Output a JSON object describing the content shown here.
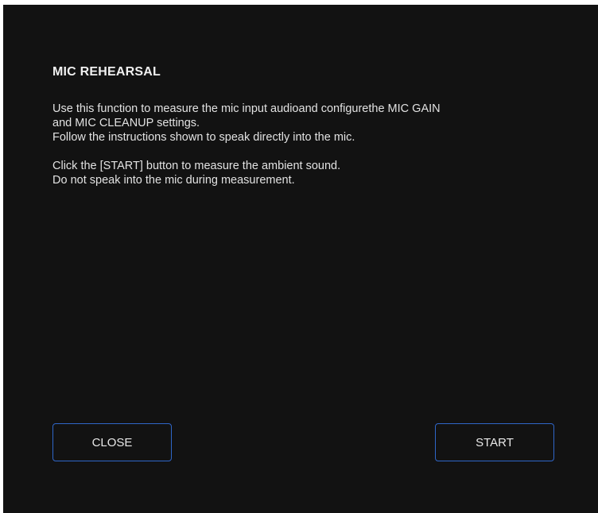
{
  "dialog": {
    "title": "MIC REHEARSAL",
    "paragraph1": "Use this function to measure the mic input audioand configurethe MIC GAIN\nand MIC CLEANUP settings.\nFollow the instructions shown to speak directly into the mic.",
    "paragraph2": "Click the [START] button to measure the ambient sound.\nDo not speak into the mic during measurement."
  },
  "buttons": {
    "close_label": "CLOSE",
    "start_label": "START"
  },
  "colors": {
    "background": "#121212",
    "button_border": "#2f66c8",
    "text": "#e6e6e6"
  }
}
